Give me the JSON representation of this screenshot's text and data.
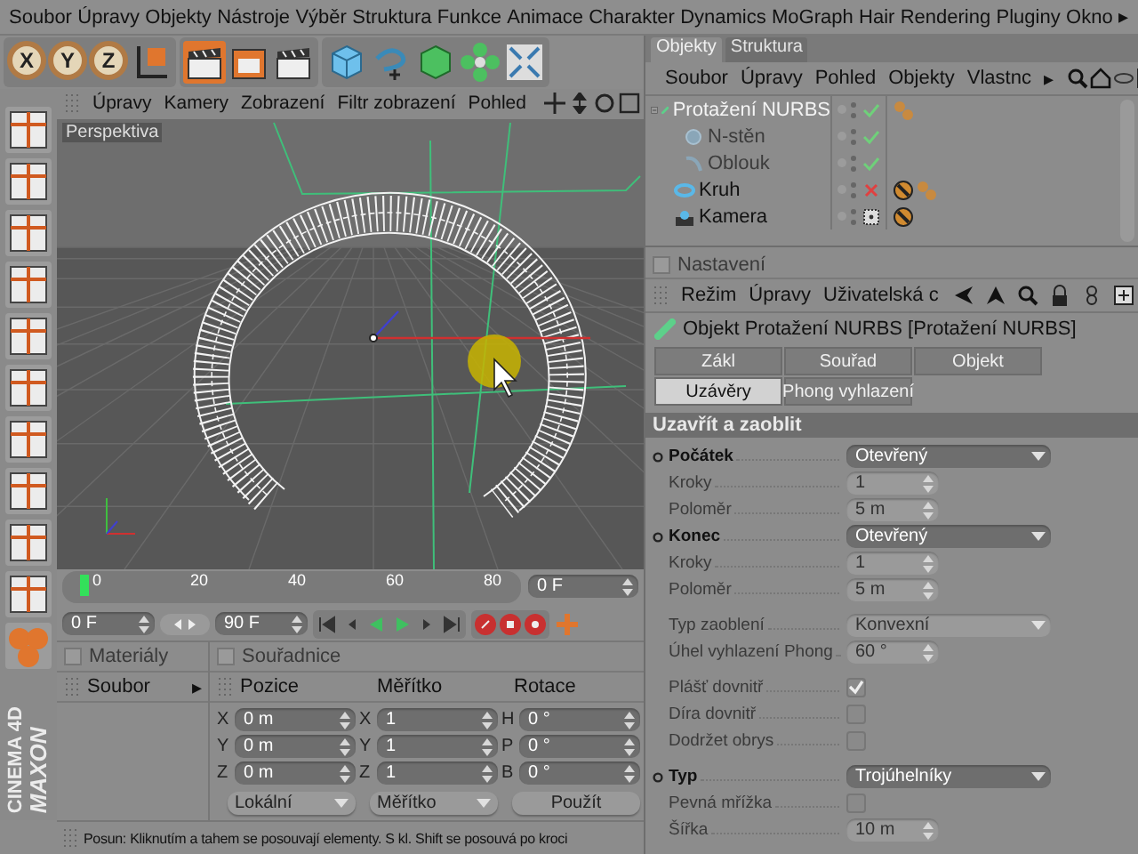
{
  "menu_bar": {
    "items": [
      "Soubor",
      "Úpravy",
      "Objekty",
      "Nástroje",
      "Výběr",
      "Struktura",
      "Funkce",
      "Animace",
      "Charakter",
      "Dynamics",
      "MoGraph",
      "Hair",
      "Rendering",
      "Pluginy",
      "Okno"
    ],
    "more": "▸"
  },
  "toolbar": {
    "axis_buttons": [
      "X",
      "Y",
      "Z"
    ]
  },
  "viewport": {
    "menu": [
      "Úpravy",
      "Kamery",
      "Zobrazení",
      "Filtr zobrazení",
      "Pohled"
    ],
    "label": "Perspektiva"
  },
  "timeline": {
    "ticks": [
      "0",
      "20",
      "40",
      "60",
      "80"
    ],
    "level": 0,
    "current_frame": "0 F"
  },
  "transport": {
    "start_frame": "0 F",
    "end_frame": "90 F"
  },
  "materials": {
    "title": "Materiály",
    "checked": false,
    "menu": "Soubor",
    "more": "▸"
  },
  "coordinates": {
    "title": "Souřadnice",
    "checked": false,
    "columns": [
      "Pozice",
      "Měřítko",
      "Rotace"
    ],
    "rows": [
      [
        {
          "axis": "X",
          "value": "0 m"
        },
        {
          "axis": "X",
          "value": "1"
        },
        {
          "axis": "H",
          "value": "0 °"
        }
      ],
      [
        {
          "axis": "Y",
          "value": "0 m"
        },
        {
          "axis": "Y",
          "value": "1"
        },
        {
          "axis": "P",
          "value": "0 °"
        }
      ],
      [
        {
          "axis": "Z",
          "value": "0 m"
        },
        {
          "axis": "Z",
          "value": "1"
        },
        {
          "axis": "B",
          "value": "0 °"
        }
      ]
    ],
    "mode": "Lokální",
    "scale_mode": "Měřítko",
    "apply": "Použít"
  },
  "status_bar": "Posun: Kliknutím a tahem se posouvají elementy. S kl. Shift se posouvá po kroci",
  "logo": {
    "brand": "MAXON",
    "product": "CINEMA 4D"
  },
  "objects_panel": {
    "tabs": [
      {
        "label": "Objekty",
        "selected": true
      },
      {
        "label": "Struktura",
        "selected": false
      }
    ],
    "menu": [
      "Soubor",
      "Úpravy",
      "Pohled",
      "Objekty",
      "Vlastnc"
    ],
    "more": "▸",
    "tree": [
      {
        "name": "Protažení NURBS",
        "kind": "sweep",
        "selected": true,
        "disabled": false,
        "expanded": true,
        "enabled": true,
        "tags": [
          {
            "kind": "phong"
          }
        ],
        "children": [
          {
            "name": "N-stěn",
            "kind": "ngon",
            "selected": false,
            "disabled": true,
            "enabled": true
          },
          {
            "name": "Oblouk",
            "kind": "arc",
            "selected": false,
            "disabled": true,
            "enabled": true
          }
        ]
      },
      {
        "name": "Kruh",
        "kind": "circle",
        "selected": false,
        "disabled": false,
        "enabled": false,
        "tags": [
          {
            "kind": "display"
          },
          {
            "kind": "phong"
          }
        ]
      },
      {
        "name": "Kamera",
        "kind": "camera",
        "selected": false,
        "disabled": false,
        "enabled": true,
        "tags": [
          {
            "kind": "display"
          }
        ]
      }
    ]
  },
  "attributes": {
    "title": "Nastavení",
    "checked": false,
    "menu": [
      "Režim",
      "Úpravy",
      "Uživatelská c"
    ],
    "object_title": "Objekt Protažení NURBS [Protažení NURBS]",
    "tabs": [
      {
        "label": "Zákl",
        "selected": false
      },
      {
        "label": "Souřad",
        "selected": false
      },
      {
        "label": "Objekt",
        "selected": false
      },
      {
        "label": "Uzávěry",
        "selected": true
      },
      {
        "label": "Phong vyhlazení",
        "selected": false
      }
    ],
    "section": "Uzavřít a zaoblit",
    "params": [
      {
        "kind": "dropdown",
        "label": "Počátek",
        "value": "Otevřený",
        "disabled": false,
        "animatable": true,
        "group_start": false
      },
      {
        "kind": "number",
        "label": "Kroky",
        "value": "1",
        "disabled": true,
        "animatable": false,
        "group_start": false
      },
      {
        "kind": "number",
        "label": "Poloměr",
        "value": "5 m",
        "disabled": true,
        "animatable": false,
        "group_start": false
      },
      {
        "kind": "dropdown",
        "label": "Konec",
        "value": "Otevřený",
        "disabled": false,
        "animatable": true,
        "group_start": false
      },
      {
        "kind": "number",
        "label": "Kroky",
        "value": "1",
        "disabled": true,
        "animatable": false,
        "group_start": false
      },
      {
        "kind": "number",
        "label": "Poloměr",
        "value": "5 m",
        "disabled": true,
        "animatable": false,
        "group_start": false
      },
      {
        "kind": "dropdown",
        "label": "Typ zaoblení",
        "value": "Konvexní",
        "disabled": true,
        "animatable": false,
        "group_start": true
      },
      {
        "kind": "number",
        "label": "Úhel vyhlazení Phong",
        "value": "60 °",
        "disabled": true,
        "animatable": false,
        "group_start": false
      },
      {
        "kind": "checkbox",
        "label": "Plášť dovnitř",
        "checked": true,
        "disabled": true,
        "animatable": false,
        "group_start": true
      },
      {
        "kind": "checkbox",
        "label": "Díra dovnitř",
        "checked": false,
        "disabled": true,
        "animatable": false,
        "group_start": false
      },
      {
        "kind": "checkbox",
        "label": "Dodržet obrys",
        "checked": false,
        "disabled": true,
        "animatable": false,
        "group_start": false
      },
      {
        "kind": "dropdown",
        "label": "Typ",
        "value": "Trojúhelníky",
        "disabled": false,
        "animatable": true,
        "group_start": true
      },
      {
        "kind": "checkbox",
        "label": "Pevná mřížka",
        "checked": false,
        "disabled": true,
        "animatable": false,
        "group_start": false
      },
      {
        "kind": "number",
        "label": "Šířka",
        "value": "10 m",
        "disabled": true,
        "animatable": false,
        "group_start": false
      }
    ]
  }
}
